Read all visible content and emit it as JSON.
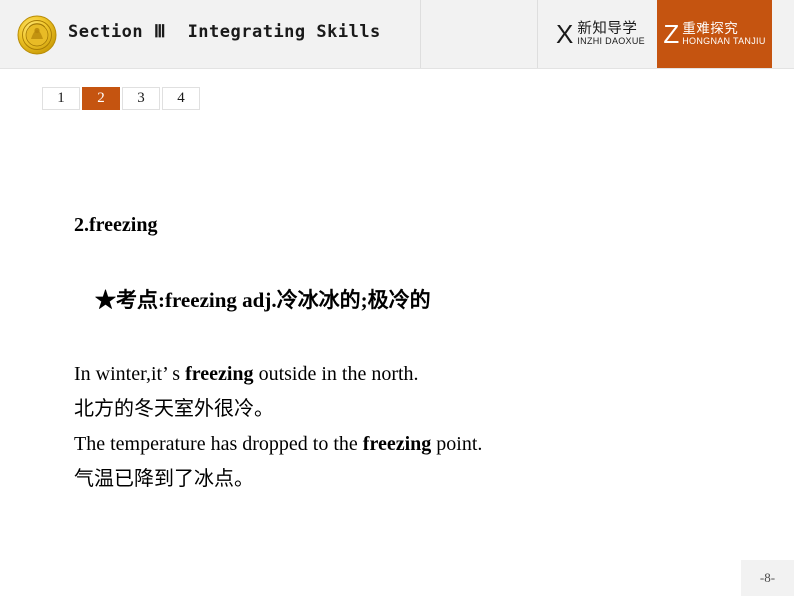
{
  "header": {
    "emblem_icon": "gold-medal-emblem-icon",
    "section_title": "Section Ⅲ  Integrating Skills",
    "nav_blocks": [
      {
        "letter": "X",
        "cn": "新知导学",
        "pinyin": "INZHI DAOXUE",
        "active": false
      },
      {
        "letter": "Z",
        "cn": "重难探究",
        "pinyin": "HONGNAN TANJIU",
        "active": true
      }
    ]
  },
  "tabs": [
    {
      "label": "1",
      "active": false
    },
    {
      "label": "2",
      "active": true
    },
    {
      "label": "3",
      "active": false
    },
    {
      "label": "4",
      "active": false
    }
  ],
  "content": {
    "heading": "2.freezing",
    "keypoint_star": "★",
    "keypoint_label": "考点:",
    "keypoint_word": "freezing adj.",
    "keypoint_meaning": "冷冰冰的;极冷的",
    "example1_pre": "In winter,it",
    "example1_apos": "’",
    "example1_mid": " s ",
    "example1_kw": "freezing",
    "example1_post": " outside in the north.",
    "example1_cn": "北方的冬天室外很冷。",
    "example2_pre": "The temperature has dropped to the ",
    "example2_kw": "freezing",
    "example2_post": " point.",
    "example2_cn": "气温已降到了冰点。"
  },
  "footer": {
    "page_number": "-8-"
  },
  "colors": {
    "accent_orange": "#c55410",
    "header_bg": "#f2f2f2",
    "text": "#000000"
  }
}
